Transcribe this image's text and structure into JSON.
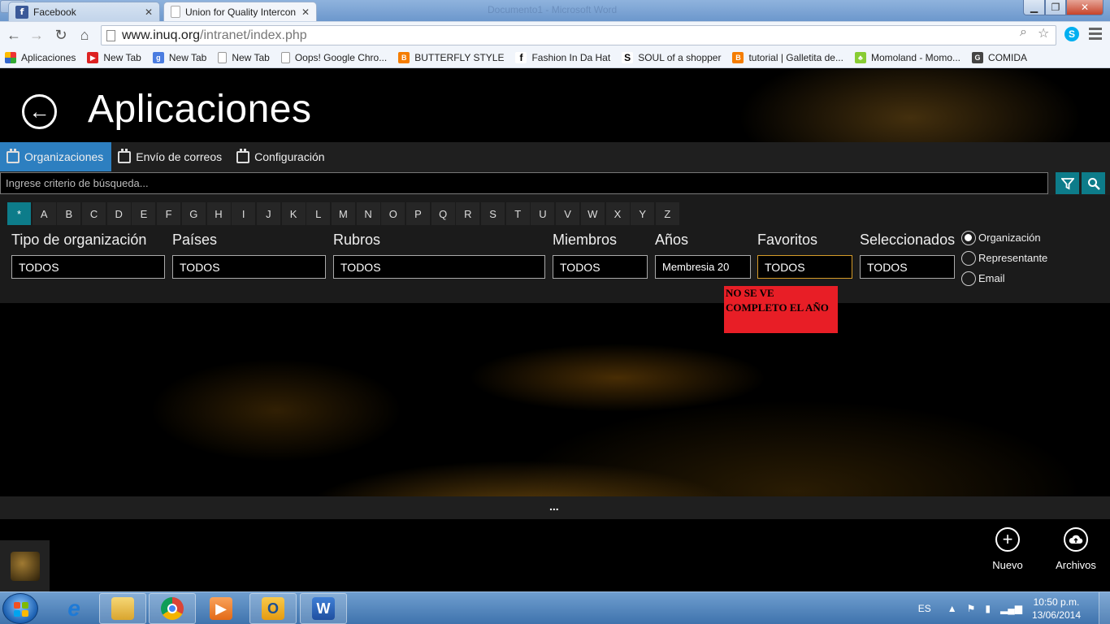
{
  "browser": {
    "tabs": [
      {
        "label": "Facebook",
        "favicon": "facebook-icon"
      },
      {
        "label": "Union for Quality Intercon",
        "favicon": "page-icon"
      }
    ],
    "window_title": "Documento1 - Microsoft Word",
    "url_domain": "www.inuq.org",
    "url_path": "/intranet/index.php",
    "bookmarks": [
      {
        "label": "Aplicaciones",
        "icon": "apps-grid-icon"
      },
      {
        "label": "New Tab",
        "icon": "youtube-icon"
      },
      {
        "label": "New Tab",
        "icon": "google-icon"
      },
      {
        "label": "New Tab",
        "icon": "page-icon"
      },
      {
        "label": "Oops! Google Chro...",
        "icon": "page-icon"
      },
      {
        "label": "BUTTERFLY STYLE",
        "icon": "blogger-icon"
      },
      {
        "label": "Fashion In Da Hat",
        "icon": "f-icon"
      },
      {
        "label": "SOUL of a shopper",
        "icon": "s-icon"
      },
      {
        "label": "tutorial | Galletita de...",
        "icon": "blogger-icon"
      },
      {
        "label": "Momoland - Momo...",
        "icon": "momoland-icon"
      },
      {
        "label": "COMIDA",
        "icon": "g-icon"
      }
    ]
  },
  "app": {
    "title": "Aplicaciones",
    "tabs": [
      {
        "label": "Organizaciones",
        "active": true
      },
      {
        "label": "Envío de correos",
        "active": false
      },
      {
        "label": "Configuración",
        "active": false
      }
    ],
    "search": {
      "placeholder": "Ingrese criterio de búsqueda...",
      "value": ""
    },
    "alphabet": [
      "*",
      "A",
      "B",
      "C",
      "D",
      "E",
      "F",
      "G",
      "H",
      "I",
      "J",
      "K",
      "L",
      "M",
      "N",
      "O",
      "P",
      "Q",
      "R",
      "S",
      "T",
      "U",
      "V",
      "W",
      "X",
      "Y",
      "Z"
    ],
    "alphabet_selected": "*",
    "filters": [
      {
        "label": "Tipo de organización",
        "value": "TODOS"
      },
      {
        "label": "Países",
        "value": "TODOS"
      },
      {
        "label": "Rubros",
        "value": "TODOS"
      },
      {
        "label": "Miembros",
        "value": "TODOS"
      },
      {
        "label": "Años",
        "value": "Membresia 20"
      },
      {
        "label": "Favoritos",
        "value": "TODOS"
      },
      {
        "label": "Seleccionados",
        "value": "TODOS"
      }
    ],
    "radio_options": [
      {
        "label": "Organización",
        "checked": true
      },
      {
        "label": "Representante",
        "checked": false
      },
      {
        "label": "Email",
        "checked": false
      }
    ],
    "annotation": "NO SE VE COMPLETO EL AÑO",
    "ellipsis": "...",
    "appbar": {
      "new_label": "Nuevo",
      "files_label": "Archivos"
    },
    "accent_color": "#0d7c8a",
    "active_tab_color": "#2d7fc0"
  },
  "taskbar": {
    "language": "ES",
    "time": "10:50 p.m.",
    "date": "13/06/2014",
    "apps": [
      "internet-explorer-icon",
      "file-explorer-icon",
      "chrome-icon",
      "media-player-icon",
      "outlook-icon",
      "word-icon"
    ]
  }
}
